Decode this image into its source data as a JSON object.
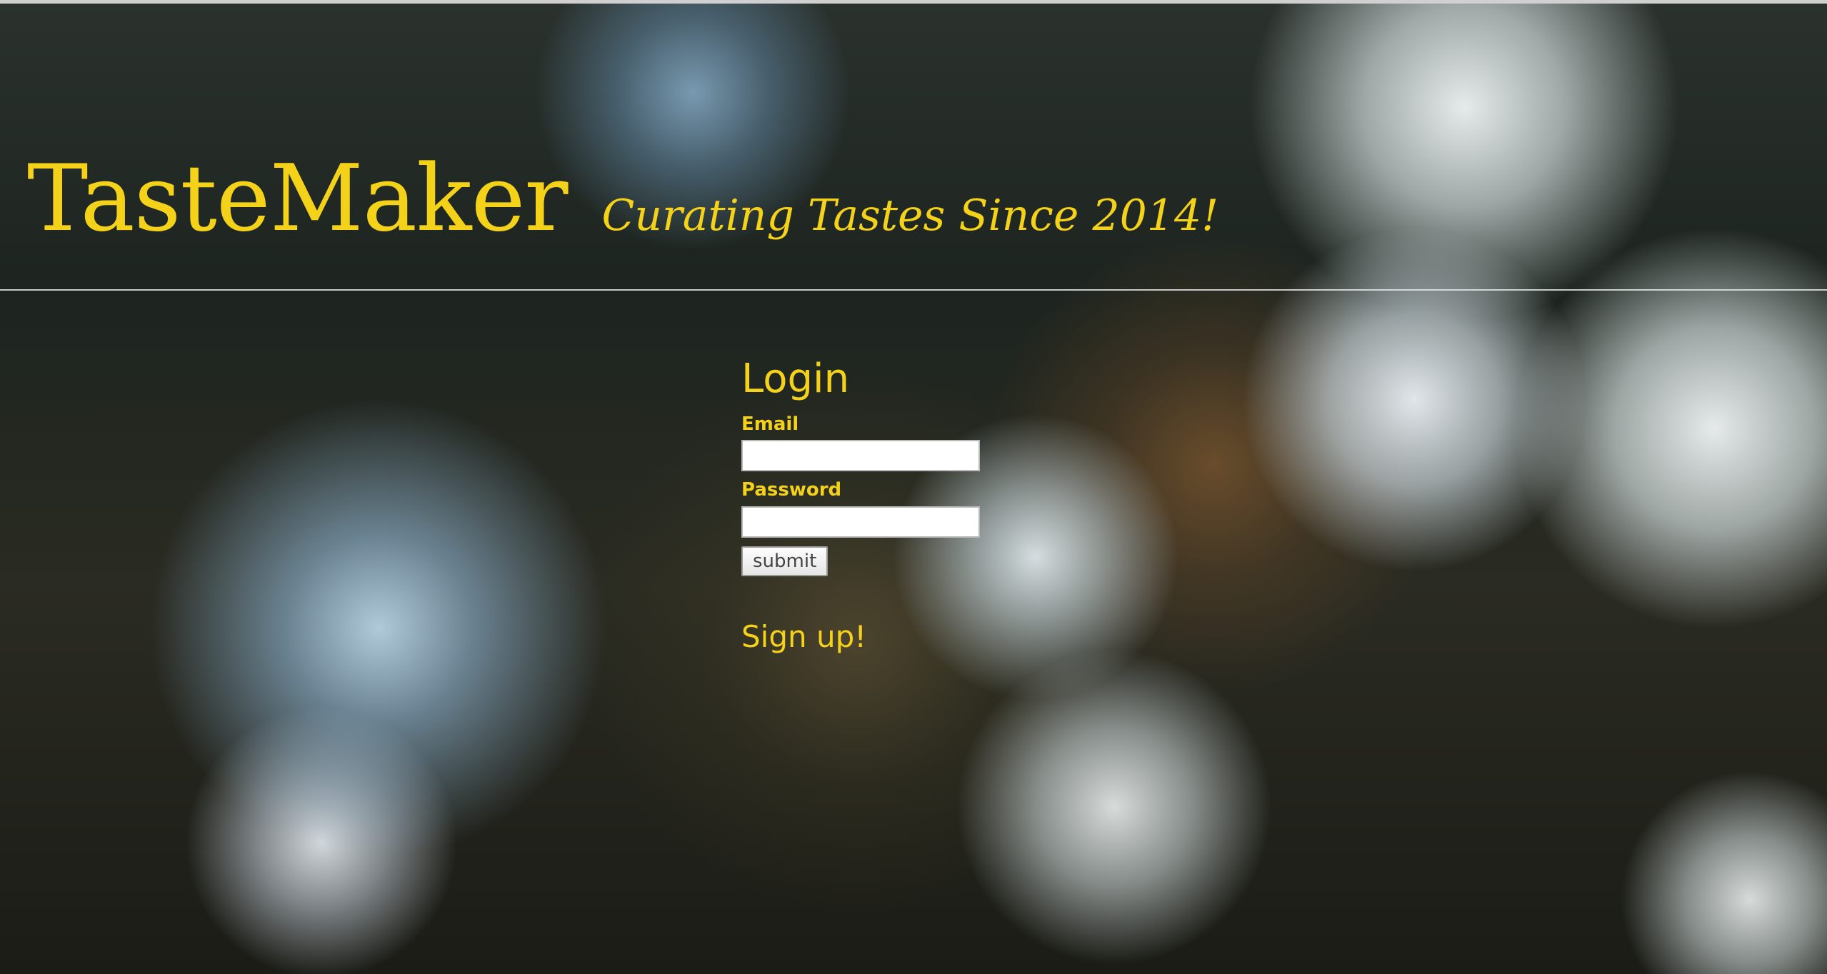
{
  "header": {
    "title": "TasteMaker",
    "tagline": "Curating Tastes Since 2014!"
  },
  "login": {
    "heading": "Login",
    "email_label": "Email",
    "email_value": "",
    "password_label": "Password",
    "password_value": "",
    "submit_label": "submit",
    "signup_label": "Sign up!"
  },
  "colors": {
    "accent": "#f5d21a",
    "divider": "#e6e6e6"
  }
}
